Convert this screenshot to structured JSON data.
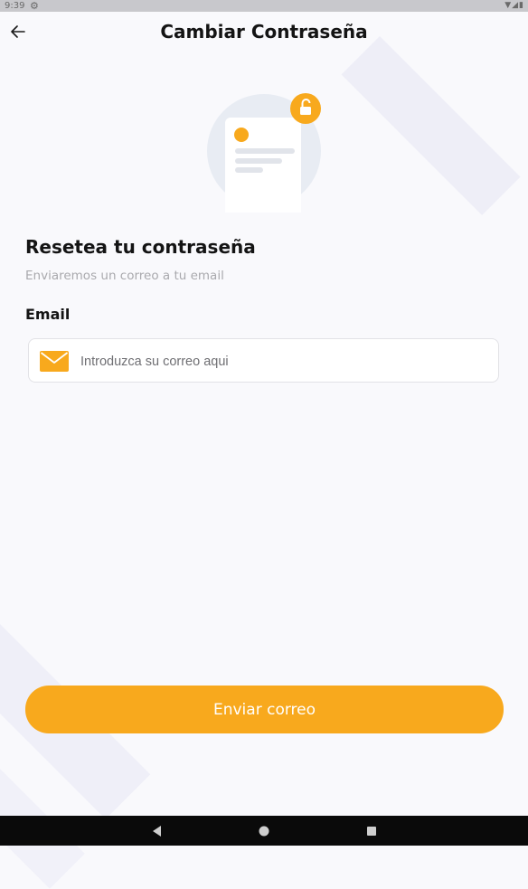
{
  "status_bar": {
    "time": "9:39"
  },
  "header": {
    "title": "Cambiar Contraseña"
  },
  "main": {
    "heading": "Resetea tu contraseña",
    "subheading": "Enviaremos un correo a tu email",
    "email_label": "Email",
    "email_placeholder": "Introduzca su correo aqui",
    "email_value": "",
    "submit_label": "Enviar correo"
  },
  "icons": {
    "back": "arrow-left-icon",
    "mail": "envelope-icon",
    "lock": "unlock-icon"
  },
  "colors": {
    "accent": "#f8a91d",
    "background": "#f9f9fc",
    "text": "#141414",
    "muted": "#a9a9ad"
  }
}
